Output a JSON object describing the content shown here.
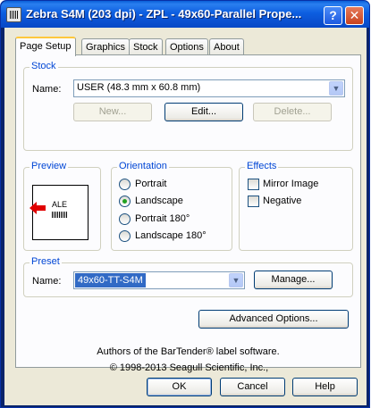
{
  "window": {
    "title": "Zebra S4M (203 dpi) - ZPL - 49x60-Parallel Prope...",
    "help_glyph": "?",
    "close_glyph": "✕"
  },
  "tabs": [
    {
      "label": "Page Setup",
      "active": true
    },
    {
      "label": "Graphics",
      "active": false
    },
    {
      "label": "Stock",
      "active": false
    },
    {
      "label": "Options",
      "active": false
    },
    {
      "label": "About",
      "active": false
    }
  ],
  "stock": {
    "title": "Stock",
    "name_label": "Name:",
    "name_value": "USER (48.3 mm x 60.8 mm)",
    "new_label": "New...",
    "edit_label": "Edit...",
    "delete_label": "Delete..."
  },
  "preview": {
    "title": "Preview",
    "label_text": "ALE"
  },
  "orientation": {
    "title": "Orientation",
    "options": [
      {
        "label": "Portrait",
        "selected": false
      },
      {
        "label": "Landscape",
        "selected": true
      },
      {
        "label": "Portrait 180°",
        "selected": false
      },
      {
        "label": "Landscape 180°",
        "selected": false
      }
    ]
  },
  "effects": {
    "title": "Effects",
    "options": [
      {
        "label": "Mirror Image",
        "checked": false
      },
      {
        "label": "Negative",
        "checked": false
      }
    ]
  },
  "preset": {
    "title": "Preset",
    "name_label": "Name:",
    "name_value": "49x60-TT-S4M",
    "manage_label": "Manage..."
  },
  "advanced_label": "Advanced Options...",
  "footer": {
    "copyright": "© 1998-2013 Seagull Scientific, Inc.,",
    "authors": "Authors of the BarTender® label software."
  },
  "buttons": {
    "ok": "OK",
    "cancel": "Cancel",
    "help": "Help"
  },
  "colors": {
    "title_bar": "#0a5fd8",
    "group_title": "#0046d5",
    "selection": "#316ac5",
    "arrow": "#e00000"
  }
}
